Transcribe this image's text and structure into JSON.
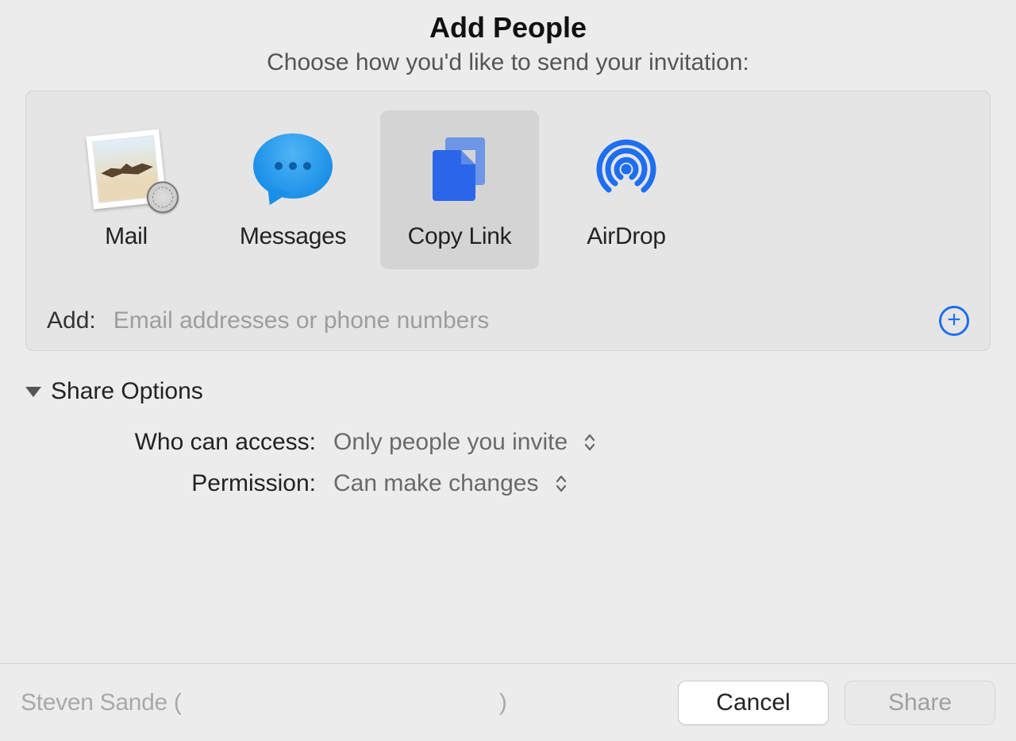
{
  "header": {
    "title": "Add People",
    "subtitle": "Choose how you'd like to send your invitation:"
  },
  "methods": [
    {
      "id": "mail",
      "label": "Mail",
      "selected": false
    },
    {
      "id": "messages",
      "label": "Messages",
      "selected": false
    },
    {
      "id": "copylink",
      "label": "Copy Link",
      "selected": true
    },
    {
      "id": "airdrop",
      "label": "AirDrop",
      "selected": false
    }
  ],
  "add": {
    "label": "Add:",
    "placeholder": "Email addresses or phone numbers",
    "value": ""
  },
  "shareOptions": {
    "title": "Share Options",
    "expanded": true,
    "access": {
      "label": "Who can access:",
      "value": "Only people you invite"
    },
    "permission": {
      "label": "Permission:",
      "value": "Can make changes"
    }
  },
  "footer": {
    "owner_prefix": "Steven Sande (",
    "owner_suffix": ")",
    "cancel": "Cancel",
    "share": "Share",
    "share_enabled": false
  },
  "colors": {
    "accent_blue": "#1e6ef0",
    "selected_bg": "#d4d4d4"
  }
}
